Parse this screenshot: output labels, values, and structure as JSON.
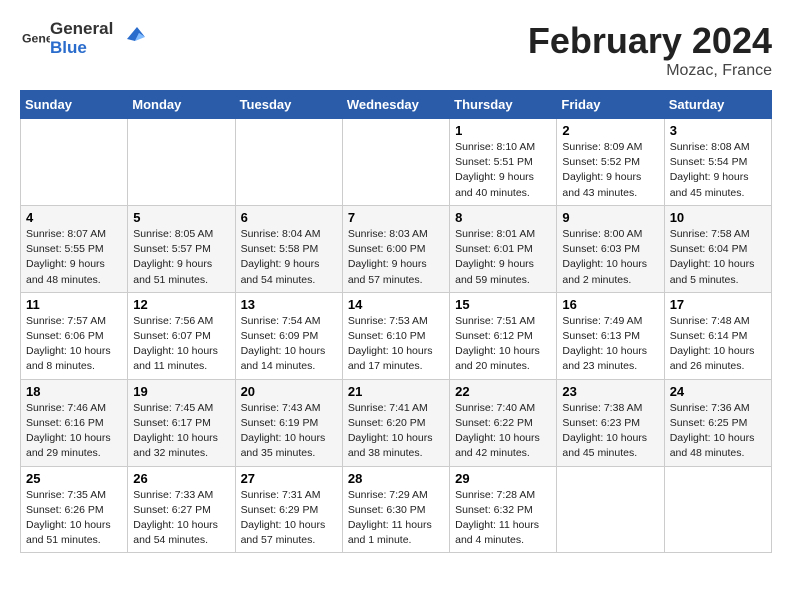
{
  "header": {
    "logo_general": "General",
    "logo_blue": "Blue",
    "month": "February 2024",
    "location": "Mozac, France"
  },
  "columns": [
    "Sunday",
    "Monday",
    "Tuesday",
    "Wednesday",
    "Thursday",
    "Friday",
    "Saturday"
  ],
  "weeks": [
    [
      {
        "day": "",
        "info": ""
      },
      {
        "day": "",
        "info": ""
      },
      {
        "day": "",
        "info": ""
      },
      {
        "day": "",
        "info": ""
      },
      {
        "day": "1",
        "info": "Sunrise: 8:10 AM\nSunset: 5:51 PM\nDaylight: 9 hours\nand 40 minutes."
      },
      {
        "day": "2",
        "info": "Sunrise: 8:09 AM\nSunset: 5:52 PM\nDaylight: 9 hours\nand 43 minutes."
      },
      {
        "day": "3",
        "info": "Sunrise: 8:08 AM\nSunset: 5:54 PM\nDaylight: 9 hours\nand 45 minutes."
      }
    ],
    [
      {
        "day": "4",
        "info": "Sunrise: 8:07 AM\nSunset: 5:55 PM\nDaylight: 9 hours\nand 48 minutes."
      },
      {
        "day": "5",
        "info": "Sunrise: 8:05 AM\nSunset: 5:57 PM\nDaylight: 9 hours\nand 51 minutes."
      },
      {
        "day": "6",
        "info": "Sunrise: 8:04 AM\nSunset: 5:58 PM\nDaylight: 9 hours\nand 54 minutes."
      },
      {
        "day": "7",
        "info": "Sunrise: 8:03 AM\nSunset: 6:00 PM\nDaylight: 9 hours\nand 57 minutes."
      },
      {
        "day": "8",
        "info": "Sunrise: 8:01 AM\nSunset: 6:01 PM\nDaylight: 9 hours\nand 59 minutes."
      },
      {
        "day": "9",
        "info": "Sunrise: 8:00 AM\nSunset: 6:03 PM\nDaylight: 10 hours\nand 2 minutes."
      },
      {
        "day": "10",
        "info": "Sunrise: 7:58 AM\nSunset: 6:04 PM\nDaylight: 10 hours\nand 5 minutes."
      }
    ],
    [
      {
        "day": "11",
        "info": "Sunrise: 7:57 AM\nSunset: 6:06 PM\nDaylight: 10 hours\nand 8 minutes."
      },
      {
        "day": "12",
        "info": "Sunrise: 7:56 AM\nSunset: 6:07 PM\nDaylight: 10 hours\nand 11 minutes."
      },
      {
        "day": "13",
        "info": "Sunrise: 7:54 AM\nSunset: 6:09 PM\nDaylight: 10 hours\nand 14 minutes."
      },
      {
        "day": "14",
        "info": "Sunrise: 7:53 AM\nSunset: 6:10 PM\nDaylight: 10 hours\nand 17 minutes."
      },
      {
        "day": "15",
        "info": "Sunrise: 7:51 AM\nSunset: 6:12 PM\nDaylight: 10 hours\nand 20 minutes."
      },
      {
        "day": "16",
        "info": "Sunrise: 7:49 AM\nSunset: 6:13 PM\nDaylight: 10 hours\nand 23 minutes."
      },
      {
        "day": "17",
        "info": "Sunrise: 7:48 AM\nSunset: 6:14 PM\nDaylight: 10 hours\nand 26 minutes."
      }
    ],
    [
      {
        "day": "18",
        "info": "Sunrise: 7:46 AM\nSunset: 6:16 PM\nDaylight: 10 hours\nand 29 minutes."
      },
      {
        "day": "19",
        "info": "Sunrise: 7:45 AM\nSunset: 6:17 PM\nDaylight: 10 hours\nand 32 minutes."
      },
      {
        "day": "20",
        "info": "Sunrise: 7:43 AM\nSunset: 6:19 PM\nDaylight: 10 hours\nand 35 minutes."
      },
      {
        "day": "21",
        "info": "Sunrise: 7:41 AM\nSunset: 6:20 PM\nDaylight: 10 hours\nand 38 minutes."
      },
      {
        "day": "22",
        "info": "Sunrise: 7:40 AM\nSunset: 6:22 PM\nDaylight: 10 hours\nand 42 minutes."
      },
      {
        "day": "23",
        "info": "Sunrise: 7:38 AM\nSunset: 6:23 PM\nDaylight: 10 hours\nand 45 minutes."
      },
      {
        "day": "24",
        "info": "Sunrise: 7:36 AM\nSunset: 6:25 PM\nDaylight: 10 hours\nand 48 minutes."
      }
    ],
    [
      {
        "day": "25",
        "info": "Sunrise: 7:35 AM\nSunset: 6:26 PM\nDaylight: 10 hours\nand 51 minutes."
      },
      {
        "day": "26",
        "info": "Sunrise: 7:33 AM\nSunset: 6:27 PM\nDaylight: 10 hours\nand 54 minutes."
      },
      {
        "day": "27",
        "info": "Sunrise: 7:31 AM\nSunset: 6:29 PM\nDaylight: 10 hours\nand 57 minutes."
      },
      {
        "day": "28",
        "info": "Sunrise: 7:29 AM\nSunset: 6:30 PM\nDaylight: 11 hours\nand 1 minute."
      },
      {
        "day": "29",
        "info": "Sunrise: 7:28 AM\nSunset: 6:32 PM\nDaylight: 11 hours\nand 4 minutes."
      },
      {
        "day": "",
        "info": ""
      },
      {
        "day": "",
        "info": ""
      }
    ]
  ]
}
